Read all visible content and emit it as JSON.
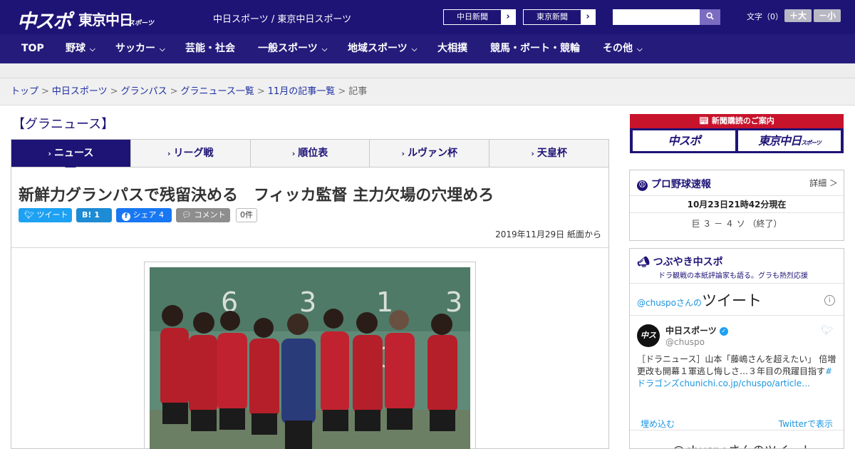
{
  "header": {
    "logo_chuspo": "中スポ",
    "logo_tokyo": "東京中日",
    "logo_tokyo_sub": "スポーツ",
    "site_name": "中日スポーツ / 東京中日スポーツ",
    "ext_links": [
      {
        "label": "中日新聞",
        "arrow": "›"
      },
      {
        "label": "東京新聞",
        "arrow": "›"
      }
    ],
    "search_placeholder": "",
    "font_size_label": "文字（0）",
    "font_plus": "＋大",
    "font_minus": "－小"
  },
  "nav": {
    "items": [
      {
        "label": "TOP",
        "dropdown": false
      },
      {
        "label": "野球",
        "dropdown": true
      },
      {
        "label": "サッカー",
        "dropdown": true
      },
      {
        "label": "芸能・社会",
        "dropdown": false
      },
      {
        "label": "一般スポーツ",
        "dropdown": true
      },
      {
        "label": "地域スポーツ",
        "dropdown": true
      },
      {
        "label": "大相撲",
        "dropdown": false
      },
      {
        "label": "競馬・ボート・競輪",
        "dropdown": false
      },
      {
        "label": "その他",
        "dropdown": true
      }
    ]
  },
  "breadcrumb": {
    "items": [
      "トップ",
      "中日スポーツ",
      "グランパス",
      "グラニュース一覧",
      "11月の記事一覧"
    ],
    "current": "記事",
    "separator": ">"
  },
  "section_title": "【グラニュース】",
  "tabs": [
    {
      "label": "ニュース",
      "active": true
    },
    {
      "label": "リーグ戦",
      "active": false
    },
    {
      "label": "順位表",
      "active": false
    },
    {
      "label": "ルヴァン杯",
      "active": false
    },
    {
      "label": "天皇杯",
      "active": false
    }
  ],
  "article": {
    "headline": "新鮮力グランパスで残留決める　フィッカ監督 主力欠場の穴埋めろ",
    "share": {
      "tweet": "ツイート",
      "hatena": "B! 1",
      "facebook": "シェア 4",
      "comment": "コメント",
      "comment_count": "0件"
    },
    "dateline": "2019年11月29日 紙面から"
  },
  "sidebar": {
    "ad": {
      "top": "新聞購読のご案内",
      "left": "中スポ",
      "right": "東京中日",
      "right_sub": "スポーツ"
    },
    "baseball": {
      "title": "プロ野球速報",
      "detail": "詳細 ＞",
      "time": "10月23日21時42分現在",
      "score": "巨 ３ － ４ ソ （終了）"
    },
    "tweets": {
      "title": "つぶやき中スポ",
      "subtitle": "ドラ観戦の本紙評論家も語る。グラも熱烈応援",
      "embed_handle": "@chuspoさんの",
      "embed_big": "ツイート",
      "user_name": "中日スポーツ",
      "user_handle": "@chuspo",
      "avatar_text": "中スポ",
      "tweet_text": "［ドラニュース］山本「藤嶋さんを超えたい」 倍増更改も開幕１軍逃し悔しさ…３年目の飛躍目指す",
      "tweet_link": "#ドラゴンズchunichi.co.jp/chuspo/article…",
      "embed_link": "埋め込む",
      "view_link": "Twitterで表示",
      "footer": "@chuspoさんのツイート"
    }
  },
  "colors": {
    "brand_navy": "#1e1476",
    "nav_bg": "#241b7b",
    "ad_red": "#c7132b",
    "twitter_blue": "#1da1f2"
  }
}
